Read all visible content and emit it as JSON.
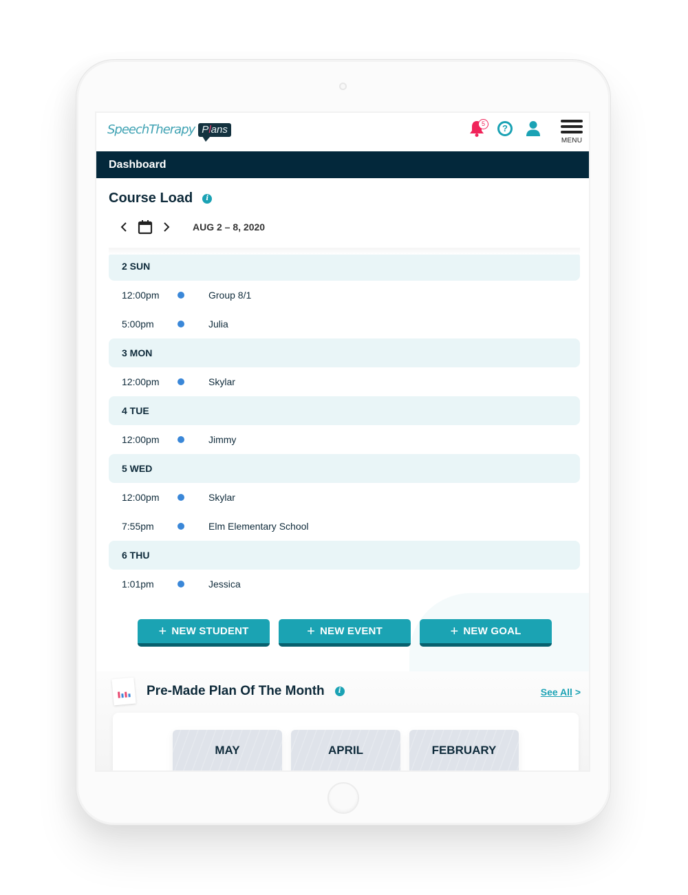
{
  "header": {
    "logo_text": "SpeechTherapy",
    "logo_badge_start": "P",
    "logo_badge_pink": "l",
    "logo_badge_end": "ans",
    "notification_count": "5",
    "help_glyph": "?",
    "menu_label": "MENU",
    "icons": {
      "notifications": "bell-icon",
      "help": "help-circle-icon",
      "profile": "user-icon",
      "menu": "hamburger-menu-icon"
    }
  },
  "nav": {
    "page_title": "Dashboard"
  },
  "course_load": {
    "title": "Course Load",
    "info_glyph": "i",
    "date_range": "AUG 2 – 8, 2020",
    "days": [
      {
        "label": "2 SUN",
        "events": [
          {
            "time": "12:00pm",
            "name": "Group 8/1"
          },
          {
            "time": "5:00pm",
            "name": "Julia"
          }
        ]
      },
      {
        "label": "3 MON",
        "events": [
          {
            "time": "12:00pm",
            "name": "Skylar"
          }
        ]
      },
      {
        "label": "4 TUE",
        "events": [
          {
            "time": "12:00pm",
            "name": "Jimmy"
          }
        ]
      },
      {
        "label": "5 WED",
        "events": [
          {
            "time": "12:00pm",
            "name": "Skylar"
          },
          {
            "time": "7:55pm",
            "name": "Elm Elementary School"
          }
        ]
      },
      {
        "label": "6 THU",
        "events": [
          {
            "time": "1:01pm",
            "name": "Jessica"
          }
        ]
      }
    ]
  },
  "actions": {
    "new_student": "NEW STUDENT",
    "new_event": "NEW EVENT",
    "new_goal": "NEW GOAL",
    "plus": "+"
  },
  "plan_of_month": {
    "title": "Pre-Made Plan Of The Month",
    "info_glyph": "i",
    "see_all": "See All",
    "see_all_arrow": ">",
    "months": [
      "MAY",
      "APRIL",
      "FEBRUARY"
    ]
  },
  "colors": {
    "brand_teal": "#1ba3b3",
    "dark_navy": "#03283b",
    "notification_pink": "#f0245a",
    "event_dot_blue": "#3a87d8",
    "day_header_bg": "#e9f5f7"
  }
}
